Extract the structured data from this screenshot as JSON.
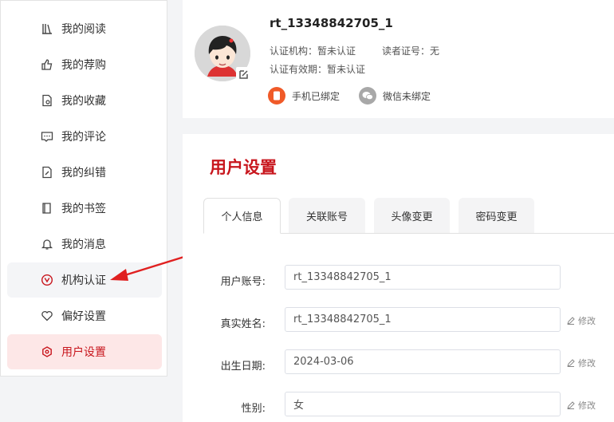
{
  "sidebar": {
    "items": [
      {
        "label": "我的阅读",
        "icon": "bookshelf-icon"
      },
      {
        "label": "我的荐购",
        "icon": "thumbs-up-icon"
      },
      {
        "label": "我的收藏",
        "icon": "bookmark-doc-icon"
      },
      {
        "label": "我的评论",
        "icon": "comment-icon"
      },
      {
        "label": "我的纠错",
        "icon": "edit-doc-icon"
      },
      {
        "label": "我的书签",
        "icon": "book-icon"
      },
      {
        "label": "我的消息",
        "icon": "bell-icon"
      },
      {
        "label": "机构认证",
        "icon": "verified-icon"
      },
      {
        "label": "偏好设置",
        "icon": "heart-icon"
      },
      {
        "label": "用户设置",
        "icon": "settings-icon"
      }
    ],
    "active_index": 9,
    "hover_index": 7,
    "accent_color": "#c8161d"
  },
  "profile": {
    "username": "rt_13348842705_1",
    "org_label": "认证机构：",
    "org_value": "暂未认证",
    "reader_label": "读者证号：",
    "reader_value": "无",
    "validity_label": "认证有效期：",
    "validity_value": "暂未认证",
    "phone_status": "手机已绑定",
    "wechat_status": "微信未绑定"
  },
  "settings": {
    "title": "用户设置",
    "tabs": [
      "个人信息",
      "关联账号",
      "头像变更",
      "密码变更"
    ],
    "active_tab": 0,
    "fields": [
      {
        "label": "用户账号:",
        "value": "rt_13348842705_1",
        "editable": false
      },
      {
        "label": "真实姓名:",
        "value": "rt_13348842705_1",
        "editable": true
      },
      {
        "label": "出生日期:",
        "value": "2024-03-06",
        "editable": true
      },
      {
        "label": "性别:",
        "value": "女",
        "editable": true
      }
    ],
    "modify_label": "修改"
  }
}
